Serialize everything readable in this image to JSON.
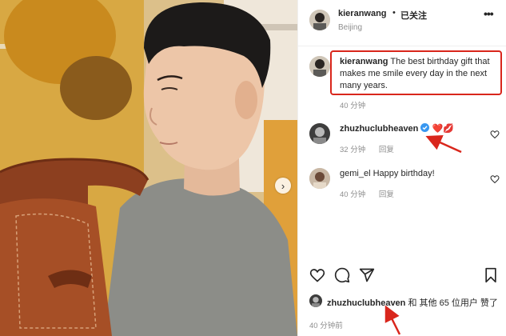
{
  "post": {
    "author": "kieranwang",
    "follow_status": "已关注",
    "location": "Beijing",
    "more_label": "•••"
  },
  "caption": {
    "author": "kieranwang",
    "text": "The best birthday gift that makes me smile every day in the next many years.",
    "time": "40 分钟"
  },
  "comments": [
    {
      "author": "zhuzhuclubheaven",
      "text": "",
      "emoji": "❤️💋",
      "time": "32 分钟",
      "reply_label": "回复"
    },
    {
      "author": "gemi_el",
      "text": "Happy birthday!",
      "time": "40 分钟",
      "reply_label": "回复"
    }
  ],
  "likes": {
    "first_user": "zhuzhuclubheaven",
    "rest_text": " 和 其他 65 位用户 赞了"
  },
  "time_ago": "40 分钟前",
  "icons": [
    "heart-icon",
    "comment-icon",
    "share-icon",
    "bookmark-icon",
    "verified-badge-icon",
    "carousel-next-icon"
  ],
  "colors": {
    "highlight_red": "#d9261c",
    "verified_blue": "#3897f0",
    "meta_gray": "#8e8e8e"
  }
}
